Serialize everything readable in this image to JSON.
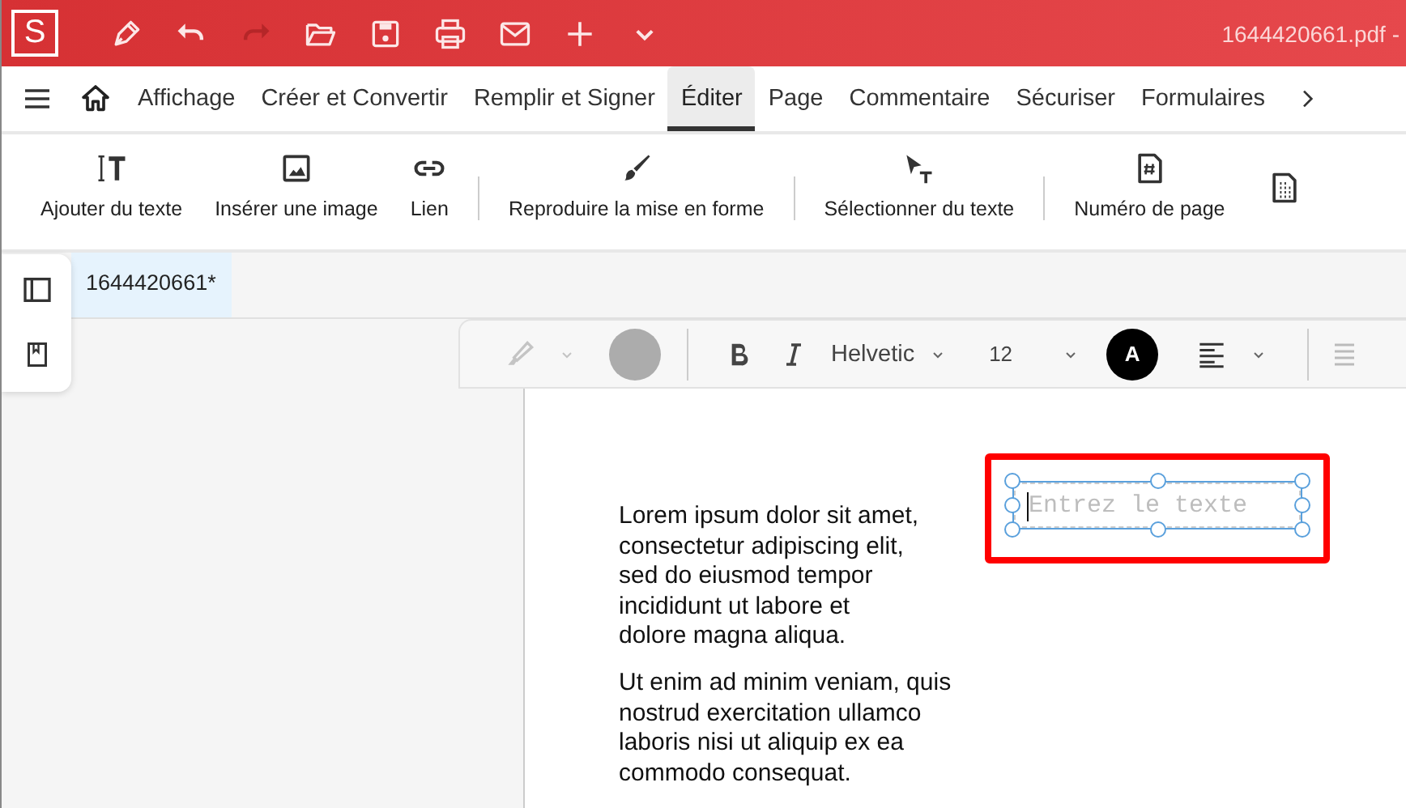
{
  "title_bar": {
    "logo": "S",
    "file_name": "1644420661.pdf -",
    "tools": [
      {
        "kind": "pen",
        "disabled": false
      },
      {
        "kind": "undo",
        "disabled": false
      },
      {
        "kind": "redo",
        "disabled": true
      },
      {
        "kind": "open",
        "disabled": false
      },
      {
        "kind": "save",
        "disabled": false
      },
      {
        "kind": "print",
        "disabled": false
      },
      {
        "kind": "mail",
        "disabled": false
      },
      {
        "kind": "plus",
        "disabled": false
      },
      {
        "kind": "more",
        "disabled": false
      }
    ]
  },
  "menu_tabs": [
    {
      "label": "Affichage",
      "selected": false
    },
    {
      "label": "Créer et Convertir",
      "selected": false
    },
    {
      "label": "Remplir et Signer",
      "selected": false
    },
    {
      "label": "Éditer",
      "selected": true
    },
    {
      "label": "Page",
      "selected": false
    },
    {
      "label": "Commentaire",
      "selected": false
    },
    {
      "label": "Sécuriser",
      "selected": false
    },
    {
      "label": "Formulaires",
      "selected": false
    }
  ],
  "ribbon_groups": [
    [
      {
        "kind": "add-text",
        "label": "Ajouter du texte"
      },
      {
        "kind": "image",
        "label": "Insérer une image"
      },
      {
        "kind": "link",
        "label": "Lien"
      }
    ],
    [
      {
        "kind": "brush",
        "label": "Reproduire la mise en forme"
      }
    ],
    [
      {
        "kind": "select-text",
        "label": "Sélectionner du texte"
      }
    ],
    [
      {
        "kind": "page-number",
        "label": "Numéro de page"
      },
      {
        "kind": "page-grid"
      }
    ]
  ],
  "document_tabs": [
    {
      "label": "1644420661*",
      "selected": true
    }
  ],
  "format_bar": {
    "highlighter_disabled": true,
    "font": "Helvetic",
    "size": "12",
    "text_color_label": "A"
  },
  "page": {
    "paragraphs": [
      [
        "Lorem ipsum dolor sit amet,",
        "consectetur adipiscing elit,",
        "sed do eiusmod tempor",
        "incididunt ut labore et",
        "dolore magna aliqua."
      ],
      [
        "Ut enim ad minim veniam, quis",
        "nostrud exercitation ullamco",
        "laboris nisi ut aliquip ex ea",
        "commodo consequat."
      ]
    ],
    "text_box": {
      "placeholder": "Entrez le texte"
    }
  }
}
